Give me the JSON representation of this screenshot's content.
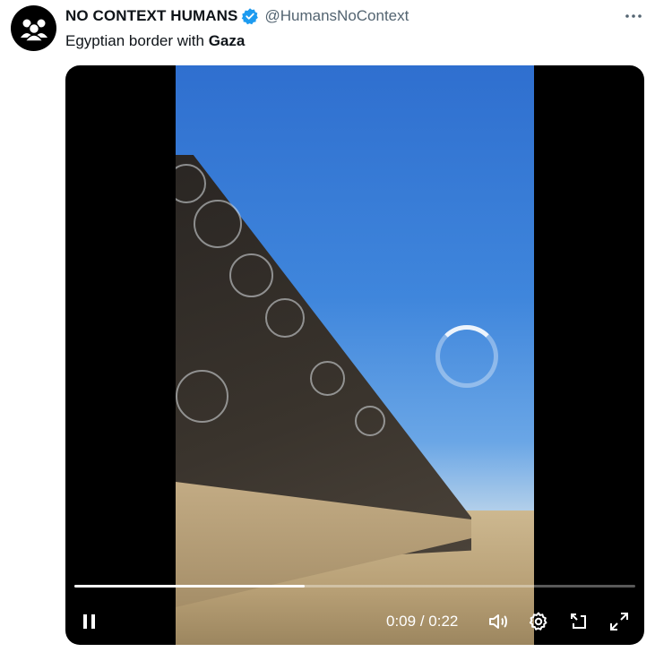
{
  "tweet": {
    "author_name": "NO CONTEXT HUMANS",
    "handle": "@HumansNoContext",
    "text_prefix": "Egyptian border with ",
    "text_bold": "Gaza"
  },
  "video": {
    "progress": 0.41,
    "current_time": "0:09",
    "separator": " / ",
    "duration": "0:22"
  },
  "icons": {
    "avatar": "people-group-icon",
    "verified": "verified-badge-icon",
    "more": "more-dots-icon",
    "pause": "pause-icon",
    "volume": "volume-icon",
    "settings": "gear-icon",
    "pip": "picture-in-picture-icon",
    "fullscreen": "fullscreen-icon",
    "loading": "loading-spinner-icon"
  },
  "colors": {
    "text": "#0f1419",
    "secondary": "#536471",
    "verified": "#1d9bf0",
    "media_bg": "#000000"
  }
}
